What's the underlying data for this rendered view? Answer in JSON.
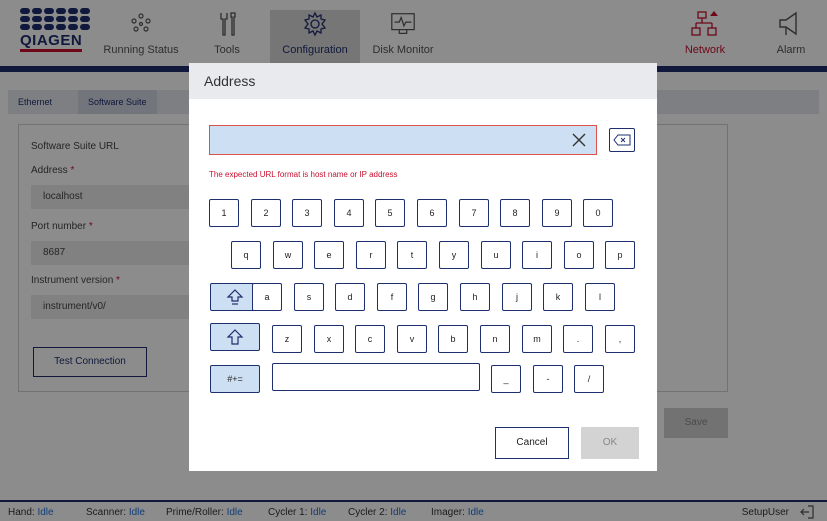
{
  "header": {
    "logo_text": "QIAGEN",
    "nav": [
      {
        "label": "Running Status",
        "icon": "running-status-icon"
      },
      {
        "label": "Tools",
        "icon": "tools-icon"
      },
      {
        "label": "Configuration",
        "icon": "gear-icon"
      },
      {
        "label": "Disk Monitor",
        "icon": "disk-monitor-icon"
      },
      {
        "label": "Network",
        "icon": "network-icon"
      },
      {
        "label": "Alarm",
        "icon": "alarm-icon"
      }
    ]
  },
  "tabs": [
    "Ethernet",
    "Software Suite"
  ],
  "form": {
    "section_title": "Software Suite URL",
    "address_label": "Address",
    "address_value": "localhost",
    "port_label": "Port number",
    "port_value": "8687",
    "version_label": "Instrument version",
    "version_value": "instrument/v0/",
    "required_mark": "*",
    "test_button": "Test Connection",
    "save_button": "Save"
  },
  "status": {
    "items": [
      {
        "label": "Hand:",
        "value": "Idle"
      },
      {
        "label": "Scanner:",
        "value": "Idle"
      },
      {
        "label": "Prime/Roller:",
        "value": "Idle"
      },
      {
        "label": "Cycler 1:",
        "value": "Idle"
      },
      {
        "label": "Cycler 2:",
        "value": "Idle"
      },
      {
        "label": "Imager:",
        "value": "Idle"
      }
    ],
    "user": "SetupUser"
  },
  "dialog": {
    "title": "Address",
    "input_value": "",
    "error": "The expected URL format is host name or IP address",
    "cancel": "Cancel",
    "ok": "OK"
  },
  "keyboard": {
    "row1": [
      "1",
      "2",
      "3",
      "4",
      "5",
      "6",
      "7",
      "8",
      "9",
      "0"
    ],
    "row2": [
      "q",
      "w",
      "e",
      "r",
      "t",
      "y",
      "u",
      "i",
      "o",
      "p"
    ],
    "row3": [
      "a",
      "s",
      "d",
      "f",
      "g",
      "h",
      "j",
      "k",
      "l"
    ],
    "row4": [
      "z",
      "x",
      "c",
      "v",
      "b",
      "n",
      "m",
      ".",
      ","
    ],
    "row5": [
      "_",
      "-",
      "/"
    ],
    "symbols_key": "#+="
  },
  "colors": {
    "brand": "#1e2f6e",
    "error": "#c8102e",
    "input_bg": "#cddff2",
    "link": "#1e6fd9"
  }
}
